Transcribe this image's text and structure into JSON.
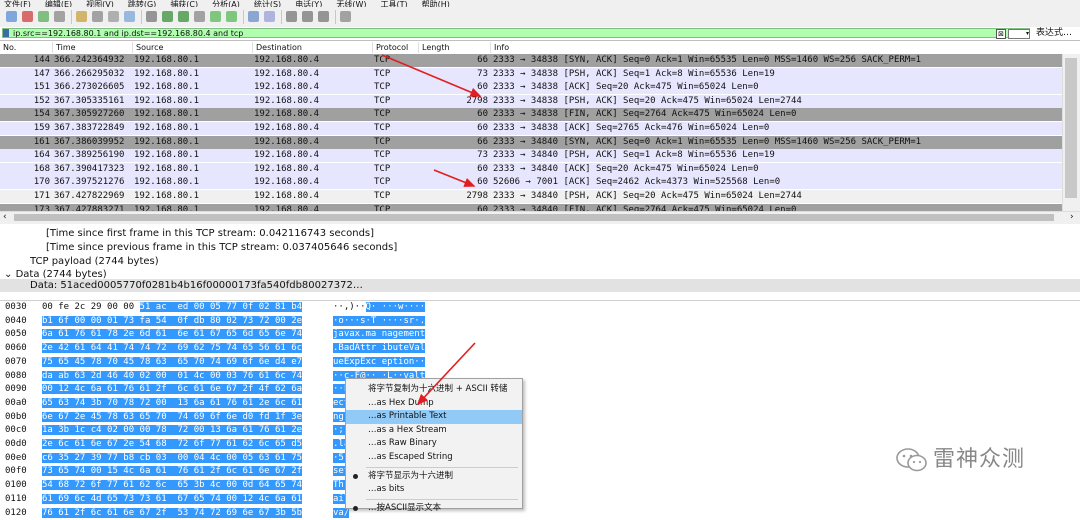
{
  "menubar": {
    "items": [
      "文件(F)",
      "编辑(E)",
      "视图(V)",
      "跳转(G)",
      "捕获(C)",
      "分析(A)",
      "统计(S)",
      "电话(Y)",
      "无线(W)",
      "工具(T)",
      "帮助(H)"
    ]
  },
  "toolbar": {
    "icons": [
      "shark-fin-icon",
      "stop-icon",
      "restart-icon",
      "options-gear-icon",
      "open-file-icon",
      "save-file-icon",
      "close-file-icon",
      "reload-icon",
      "find-icon",
      "back-arrow-icon",
      "forward-arrow-icon",
      "goto-packet-icon",
      "first-packet-icon",
      "last-packet-icon",
      "autoscroll-icon",
      "colorize-icon",
      "zoom-in-icon",
      "zoom-out-icon",
      "zoom-normal-icon",
      "resize-columns-icon"
    ]
  },
  "filter": {
    "value": "ip.src==192.168.80.1 and ip.dst==192.168.80.4 and tcp",
    "expression_label": "表达式…",
    "clear_glyph": "⊠",
    "dropdown_glyph": "▾"
  },
  "columns": [
    "No.",
    "Time",
    "Source",
    "Destination",
    "Protocol",
    "Length",
    "Info"
  ],
  "packets": [
    {
      "no": "144",
      "time": "366.242364932",
      "src": "192.168.80.1",
      "dst": "192.168.80.4",
      "proto": "TCP",
      "len": "66",
      "info": "2333 → 34838 [SYN, ACK] Seq=0 Ack=1 Win=65535 Len=0 MSS=1460 WS=256 SACK_PERM=1",
      "bg": "#a0a0a0"
    },
    {
      "no": "147",
      "time": "366.266295032",
      "src": "192.168.80.1",
      "dst": "192.168.80.4",
      "proto": "TCP",
      "len": "73",
      "info": "2333 → 34838 [PSH, ACK] Seq=1 Ack=8 Win=65536 Len=19",
      "bg": "#e7e6ff"
    },
    {
      "no": "151",
      "time": "366.273026605",
      "src": "192.168.80.1",
      "dst": "192.168.80.4",
      "proto": "TCP",
      "len": "60",
      "info": "2333 → 34838 [ACK] Seq=20 Ack=475 Win=65024 Len=0",
      "bg": "#e7e6ff"
    },
    {
      "no": "152",
      "time": "367.305335161",
      "src": "192.168.80.1",
      "dst": "192.168.80.4",
      "proto": "TCP",
      "len": "2798",
      "info": "2333 → 34838 [PSH, ACK] Seq=20 Ack=475 Win=65024 Len=2744",
      "bg": "#e7e6ff"
    },
    {
      "no": "154",
      "time": "367.305927260",
      "src": "192.168.80.1",
      "dst": "192.168.80.4",
      "proto": "TCP",
      "len": "60",
      "info": "2333 → 34838 [FIN, ACK] Seq=2764 Ack=475 Win=65024 Len=0",
      "bg": "#a0a0a0"
    },
    {
      "no": "159",
      "time": "367.383722849",
      "src": "192.168.80.1",
      "dst": "192.168.80.4",
      "proto": "TCP",
      "len": "60",
      "info": "2333 → 34838 [ACK] Seq=2765 Ack=476 Win=65024 Len=0",
      "bg": "#e7e6ff"
    },
    {
      "no": "161",
      "time": "367.386039952",
      "src": "192.168.80.1",
      "dst": "192.168.80.4",
      "proto": "TCP",
      "len": "66",
      "info": "2333 → 34840 [SYN, ACK] Seq=0 Ack=1 Win=65535 Len=0 MSS=1460 WS=256 SACK_PERM=1",
      "bg": "#a0a0a0"
    },
    {
      "no": "164",
      "time": "367.389256190",
      "src": "192.168.80.1",
      "dst": "192.168.80.4",
      "proto": "TCP",
      "len": "73",
      "info": "2333 → 34840 [PSH, ACK] Seq=1 Ack=8 Win=65536 Len=19",
      "bg": "#e7e6ff"
    },
    {
      "no": "168",
      "time": "367.390417323",
      "src": "192.168.80.1",
      "dst": "192.168.80.4",
      "proto": "TCP",
      "len": "60",
      "info": "2333 → 34840 [ACK] Seq=20 Ack=475 Win=65024 Len=0",
      "bg": "#e7e6ff"
    },
    {
      "no": "170",
      "time": "367.397521276",
      "src": "192.168.80.1",
      "dst": "192.168.80.4",
      "proto": "TCP",
      "len": "60",
      "info": "52606 → 7001 [ACK] Seq=2462 Ack=4373 Win=525568 Len=0",
      "bg": "#e7e6ff"
    },
    {
      "no": "171",
      "time": "367.427822969",
      "src": "192.168.80.1",
      "dst": "192.168.80.4",
      "proto": "TCP",
      "len": "2798",
      "info": "2333 → 34840 [PSH, ACK] Seq=20 Ack=475 Win=65024 Len=2744",
      "bg": "#f0f0f0"
    },
    {
      "no": "173",
      "time": "367.427883271",
      "src": "192.168.80.1",
      "dst": "192.168.80.4",
      "proto": "TCP",
      "len": "60",
      "info": "2333 → 34840 [FIN, ACK] Seq=2764 Ack=475 Win=65024 Len=0",
      "bg": "#a0a0a0"
    }
  ],
  "details": {
    "first_frame": "[Time since first frame in this TCP stream: 0.042116743 seconds]",
    "prev_frame": "[Time since previous frame in this TCP stream: 0.037405646 seconds]",
    "payload": "TCP payload (2744 bytes)",
    "data_header": "Data (2744 bytes)",
    "data_value": "Data: 51aced0005770f0281b4b16f00000173fa540fdb80027372…"
  },
  "bytes_rows": [
    {
      "off": "0030",
      "hex_plain": "00 fe 2c 29 00 00 ",
      "hex_hl": "51 ac  ed 00 05 77 0f 02 81 b4",
      "asc_plain": "··,)··",
      "asc_hl": "Q· ···w····"
    },
    {
      "off": "0040",
      "hex_plain": "",
      "hex_hl": "b1 6f 00 00 01 73 fa 54  0f db 80 02 73 72 00 2e",
      "asc_plain": "",
      "asc_hl": "·o···s·T ····sr·."
    },
    {
      "off": "0050",
      "hex_plain": "",
      "hex_hl": "6a 61 76 61 78 2e 6d 61  6e 61 67 65 6d 65 6e 74",
      "asc_plain": "",
      "asc_hl": "javax.ma nagement"
    },
    {
      "off": "0060",
      "hex_plain": "",
      "hex_hl": "2e 42 61 64 41 74 74 72  69 62 75 74 65 56 61 6c",
      "asc_plain": "",
      "asc_hl": ".BadAttr ibuteVal"
    },
    {
      "off": "0070",
      "hex_plain": "",
      "hex_hl": "75 65 45 78 70 45 78 63  65 70 74 69 6f 6e d4 e7",
      "asc_plain": "",
      "asc_hl": "ueExpExc eption··"
    },
    {
      "off": "0080",
      "hex_plain": "",
      "hex_hl": "da ab 63 2d 46 40 02 00  01 4c 00 03 76 61 6c 74",
      "asc_plain": "",
      "asc_hl": "··c-F@·· ·L··valt"
    },
    {
      "off": "0090",
      "hex_plain": "",
      "hex_hl": "00 12 4c 6a 61 76 61 2f  6c 61 6e 67 2f 4f 62 6a",
      "asc_plain": "",
      "asc_hl": "··Lj"
    },
    {
      "off": "00a0",
      "hex_plain": "",
      "hex_hl": "65 63 74 3b 70 78 72 00  13 6a 61 76 61 2e 6c 61",
      "asc_plain": "",
      "asc_hl": "ect"
    },
    {
      "off": "00b0",
      "hex_plain": "",
      "hex_hl": "6e 67 2e 45 78 63 65 70  74 69 6f 6e d0 fd 1f 3e",
      "asc_plain": "",
      "asc_hl": "ng."
    },
    {
      "off": "00c0",
      "hex_plain": "",
      "hex_hl": "1a 3b 1c c4 02 00 00 78  72 00 13 6a 61 76 61 2e",
      "asc_plain": "",
      "asc_hl": "·;·"
    },
    {
      "off": "00d0",
      "hex_plain": "",
      "hex_hl": "2e 6c 61 6e 67 2e 54 68  72 6f 77 61 62 6c 65 d5",
      "asc_plain": "",
      "asc_hl": ".la"
    },
    {
      "off": "00e0",
      "hex_plain": "",
      "hex_hl": "c6 35 27 39 77 b8 cb 03  00 04 4c 00 05 63 61 75",
      "asc_plain": "",
      "asc_hl": "·5'"
    },
    {
      "off": "00f0",
      "hex_plain": "",
      "hex_hl": "73 65 74 00 15 4c 6a 61  76 61 2f 6c 61 6e 67 2f",
      "asc_plain": "",
      "asc_hl": "set"
    },
    {
      "off": "0100",
      "hex_plain": "",
      "hex_hl": "54 68 72 6f 77 61 62 6c  65 3b 4c 00 0d 64 65 74",
      "asc_plain": "",
      "asc_hl": "Thr"
    },
    {
      "off": "0110",
      "hex_plain": "",
      "hex_hl": "61 69 6c 4d 65 73 73 61  67 65 74 00 12 4c 6a 61",
      "asc_plain": "",
      "asc_hl": "ail"
    },
    {
      "off": "0120",
      "hex_plain": "",
      "hex_hl": "76 61 2f 6c 61 6e 67 2f  53 74 72 69 6e 67 3b 5b",
      "asc_plain": "",
      "asc_hl": "va/"
    }
  ],
  "context_menu": {
    "items": [
      {
        "label": "将字节复制为十六进制 + ASCII 转储",
        "dot": false,
        "sel": false
      },
      {
        "label": "…as Hex Dump",
        "dot": false,
        "sel": false
      },
      {
        "label": "…as Printable Text",
        "dot": false,
        "sel": true
      },
      {
        "label": "…as a Hex Stream",
        "dot": false,
        "sel": false
      },
      {
        "label": "…as Raw Binary",
        "dot": false,
        "sel": false
      },
      {
        "label": "…as Escaped String",
        "dot": false,
        "sel": false
      },
      {
        "sep": true
      },
      {
        "label": "将字节显示为十六进制",
        "dot": true,
        "sel": false
      },
      {
        "label": "…as bits",
        "dot": false,
        "sel": false
      },
      {
        "sep": true
      },
      {
        "label": "…按ASCII显示文本",
        "dot": true,
        "sel": false
      }
    ]
  },
  "watermark": {
    "text": "雷神众测"
  },
  "colors": {
    "annotation_arrow": "#e02020",
    "byte_highlight": "#3399ff",
    "filter_ok": "#afffaf"
  }
}
